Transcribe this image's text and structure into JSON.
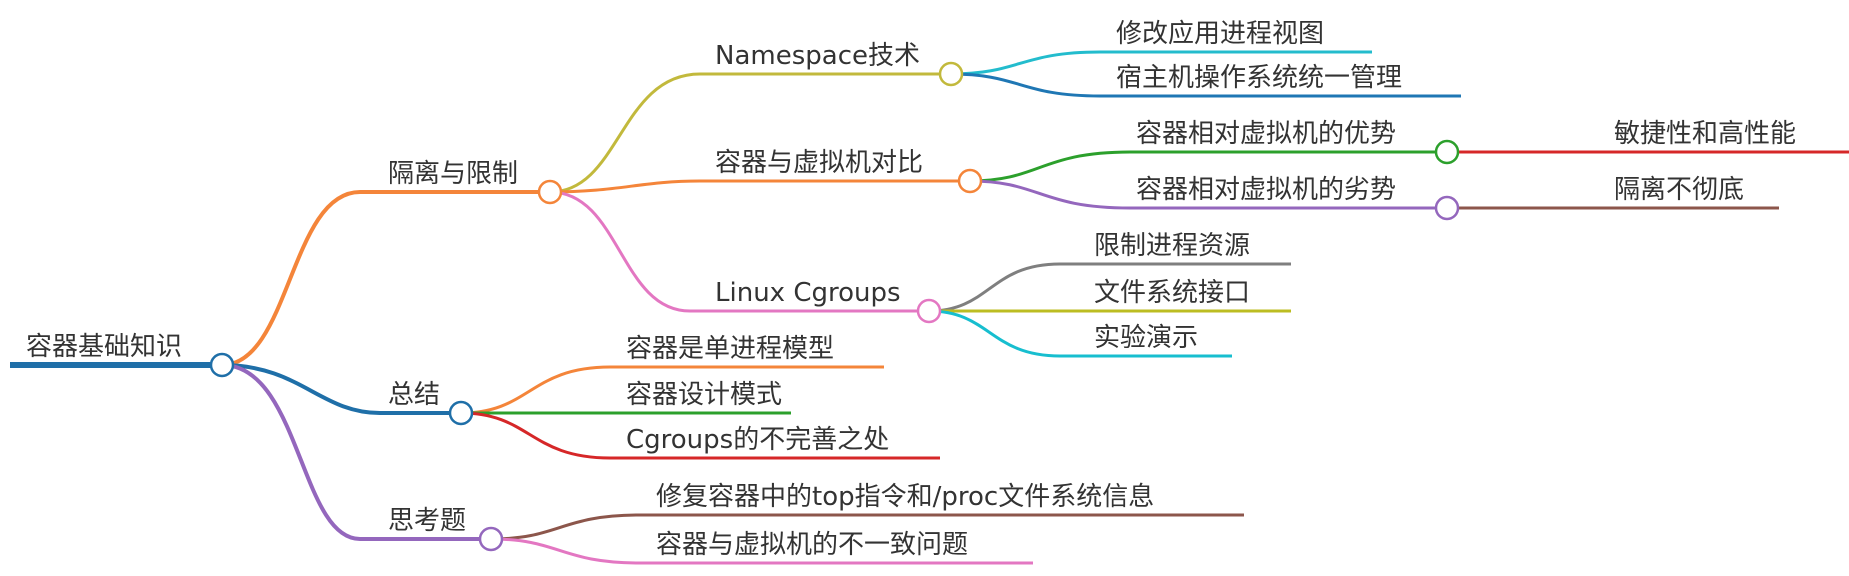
{
  "root": {
    "label": "容器基础知识",
    "color": "#1f6fa8"
  },
  "branches": [
    {
      "label": "隔离与限制",
      "color": "#f4853a",
      "children": [
        {
          "label": "Namespace技术",
          "color": "#c2b93c",
          "children": [
            {
              "label": "修改应用进程视图",
              "color": "#23bccd"
            },
            {
              "label": "宿主机操作系统统一管理",
              "color": "#1f77b4"
            }
          ]
        },
        {
          "label": "容器与虚拟机对比",
          "color": "#f4853a",
          "children": [
            {
              "label": "容器相对虚拟机的优势",
              "color": "#2ca02c",
              "children": [
                {
                  "label": "敏捷性和高性能",
                  "color": "#d62728"
                }
              ]
            },
            {
              "label": "容器相对虚拟机的劣势",
              "color": "#9467bd",
              "children": [
                {
                  "label": "隔离不彻底",
                  "color": "#8c564b"
                }
              ]
            }
          ]
        },
        {
          "label": "Linux Cgroups",
          "color": "#e377c2",
          "children": [
            {
              "label": "限制进程资源",
              "color": "#7f7f7f"
            },
            {
              "label": "文件系统接口",
              "color": "#bcbd22"
            },
            {
              "label": "实验演示",
              "color": "#17becf"
            }
          ]
        }
      ]
    },
    {
      "label": "总结",
      "color": "#1f6fa8",
      "children": [
        {
          "label": "容器是单进程模型",
          "color": "#f4853a"
        },
        {
          "label": "容器设计模式",
          "color": "#2ca02c"
        },
        {
          "label": "Cgroups的不完善之处",
          "color": "#d62728"
        }
      ]
    },
    {
      "label": "思考题",
      "color": "#9467bd",
      "children": [
        {
          "label": "修复容器中的top指令和/proc文件系统信息",
          "color": "#8c564b"
        },
        {
          "label": "容器与虚拟机的不一致问题",
          "color": "#e377c2"
        }
      ]
    }
  ]
}
